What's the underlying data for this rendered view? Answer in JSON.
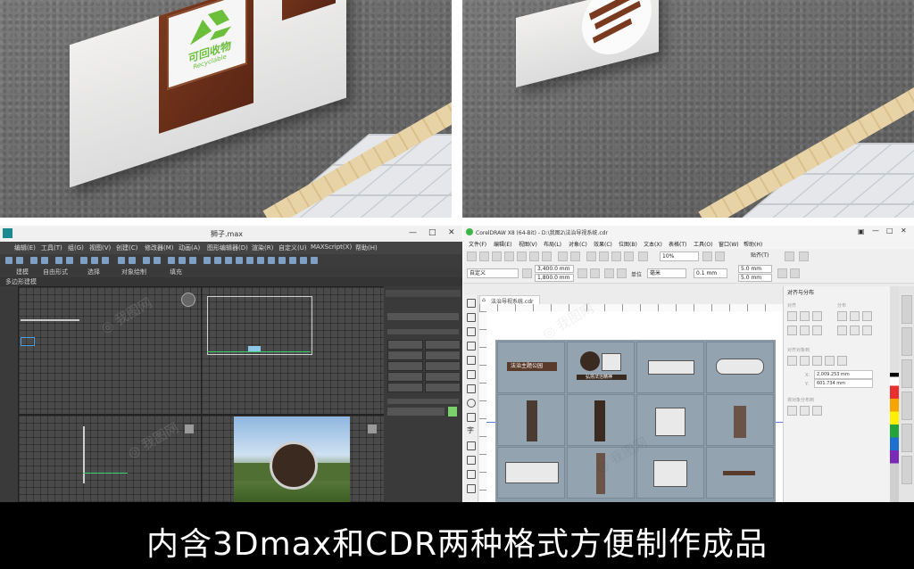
{
  "photos": {
    "left": {
      "sign_text_main": "可回收物",
      "sign_text_sub": "Recyclable"
    }
  },
  "max_window": {
    "title": "狮子.max",
    "controls": [
      "—",
      "□",
      "✕"
    ],
    "menu": [
      "编辑(E)",
      "工具(T)",
      "组(G)",
      "视图(V)",
      "创建(C)",
      "修改器(M)",
      "动画(A)",
      "图形编辑器(D)",
      "渲染(R)",
      "自定义(U)",
      "MAXScript(X)",
      "帮助(H)"
    ],
    "tabs": [
      "建模",
      "自由形式",
      "选择",
      "对象绘制",
      "填充"
    ],
    "sub_label": "多边形建模"
  },
  "cdr_window": {
    "title": "CorelDRAW X8 (64-Bit) - D:\\我图2\\法治导视系统.cdr",
    "menu": [
      "文件(F)",
      "编辑(E)",
      "视图(V)",
      "布局(L)",
      "对象(C)",
      "效果(C)",
      "位图(B)",
      "文本(X)",
      "表格(T)",
      "工具(O)",
      "窗口(W)",
      "帮助(H)"
    ],
    "zoom": "10%",
    "snap": "贴齐(T)",
    "preset": "自定义",
    "width": "3,400.0 mm",
    "height": "1,800.0 mm",
    "units_label": "单位",
    "units": "毫米",
    "nudge": "0.1 mm",
    "dup_x": "5.0 mm",
    "dup_y": "5.0 mm",
    "doc_tab": "法治导视系统.cdr",
    "dock": {
      "title": "对齐与分布",
      "section_align": "对齐",
      "section_distribute": "分布",
      "section_align_to": "对齐对象到",
      "field_x": "2,009.253 mm",
      "field_y": "601.734 mm",
      "section_distribute_to": "将对象分布到"
    },
    "sign_text_1": "法治主题公园",
    "sign_text_2": "弘扬法治精神"
  },
  "caption": "内含3Dmax和CDR两种格式方便制作成品"
}
